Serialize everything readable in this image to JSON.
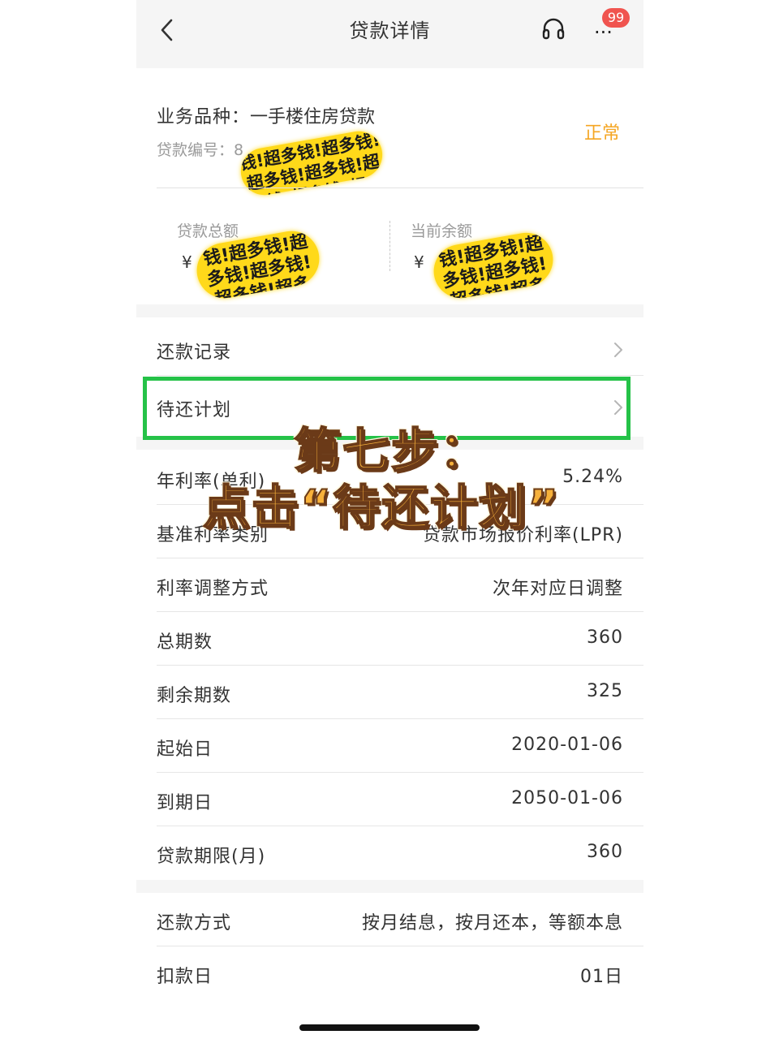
{
  "nav": {
    "title": "贷款详情",
    "back_icon": "chevron-left-icon",
    "service_icon": "headset-icon",
    "more_icon": "more-dots-icon",
    "more_glyph": "···",
    "badge": "99"
  },
  "loan": {
    "type_label": "业务品种：",
    "type_value": "一手楼住房贷款",
    "number_label": "贷款编号：",
    "number_prefix": "8",
    "status": "正常",
    "status_color": "#f5a623"
  },
  "amounts": {
    "total_label": "贷款总额",
    "total_currency": "¥",
    "balance_label": "当前余额",
    "balance_currency": "¥"
  },
  "scribble_text": "钱!超多钱!超多钱!超多钱!超多钱!超多钱!超多钱!超多",
  "links": [
    {
      "label": "还款记录"
    },
    {
      "label": "待还计划"
    }
  ],
  "details": [
    {
      "label": "年利率(单利)",
      "value": "5.24%"
    },
    {
      "label": "基准利率类别",
      "value": "贷款市场报价利率(LPR)"
    },
    {
      "label": "利率调整方式",
      "value": "次年对应日调整"
    },
    {
      "label": "总期数",
      "value": "360"
    },
    {
      "label": "剩余期数",
      "value": "325"
    },
    {
      "label": "起始日",
      "value": "2020-01-06"
    },
    {
      "label": "到期日",
      "value": "2050-01-06"
    },
    {
      "label": "贷款期限(月)",
      "value": "360"
    }
  ],
  "repayment": [
    {
      "label": "还款方式",
      "value": "按月结息，按月还本，等额本息"
    },
    {
      "label": "扣款日",
      "value": "01日"
    }
  ],
  "overlay": {
    "line1": "第七步：",
    "line2": "点击“待还计划”",
    "highlight_color": "#25c248"
  }
}
